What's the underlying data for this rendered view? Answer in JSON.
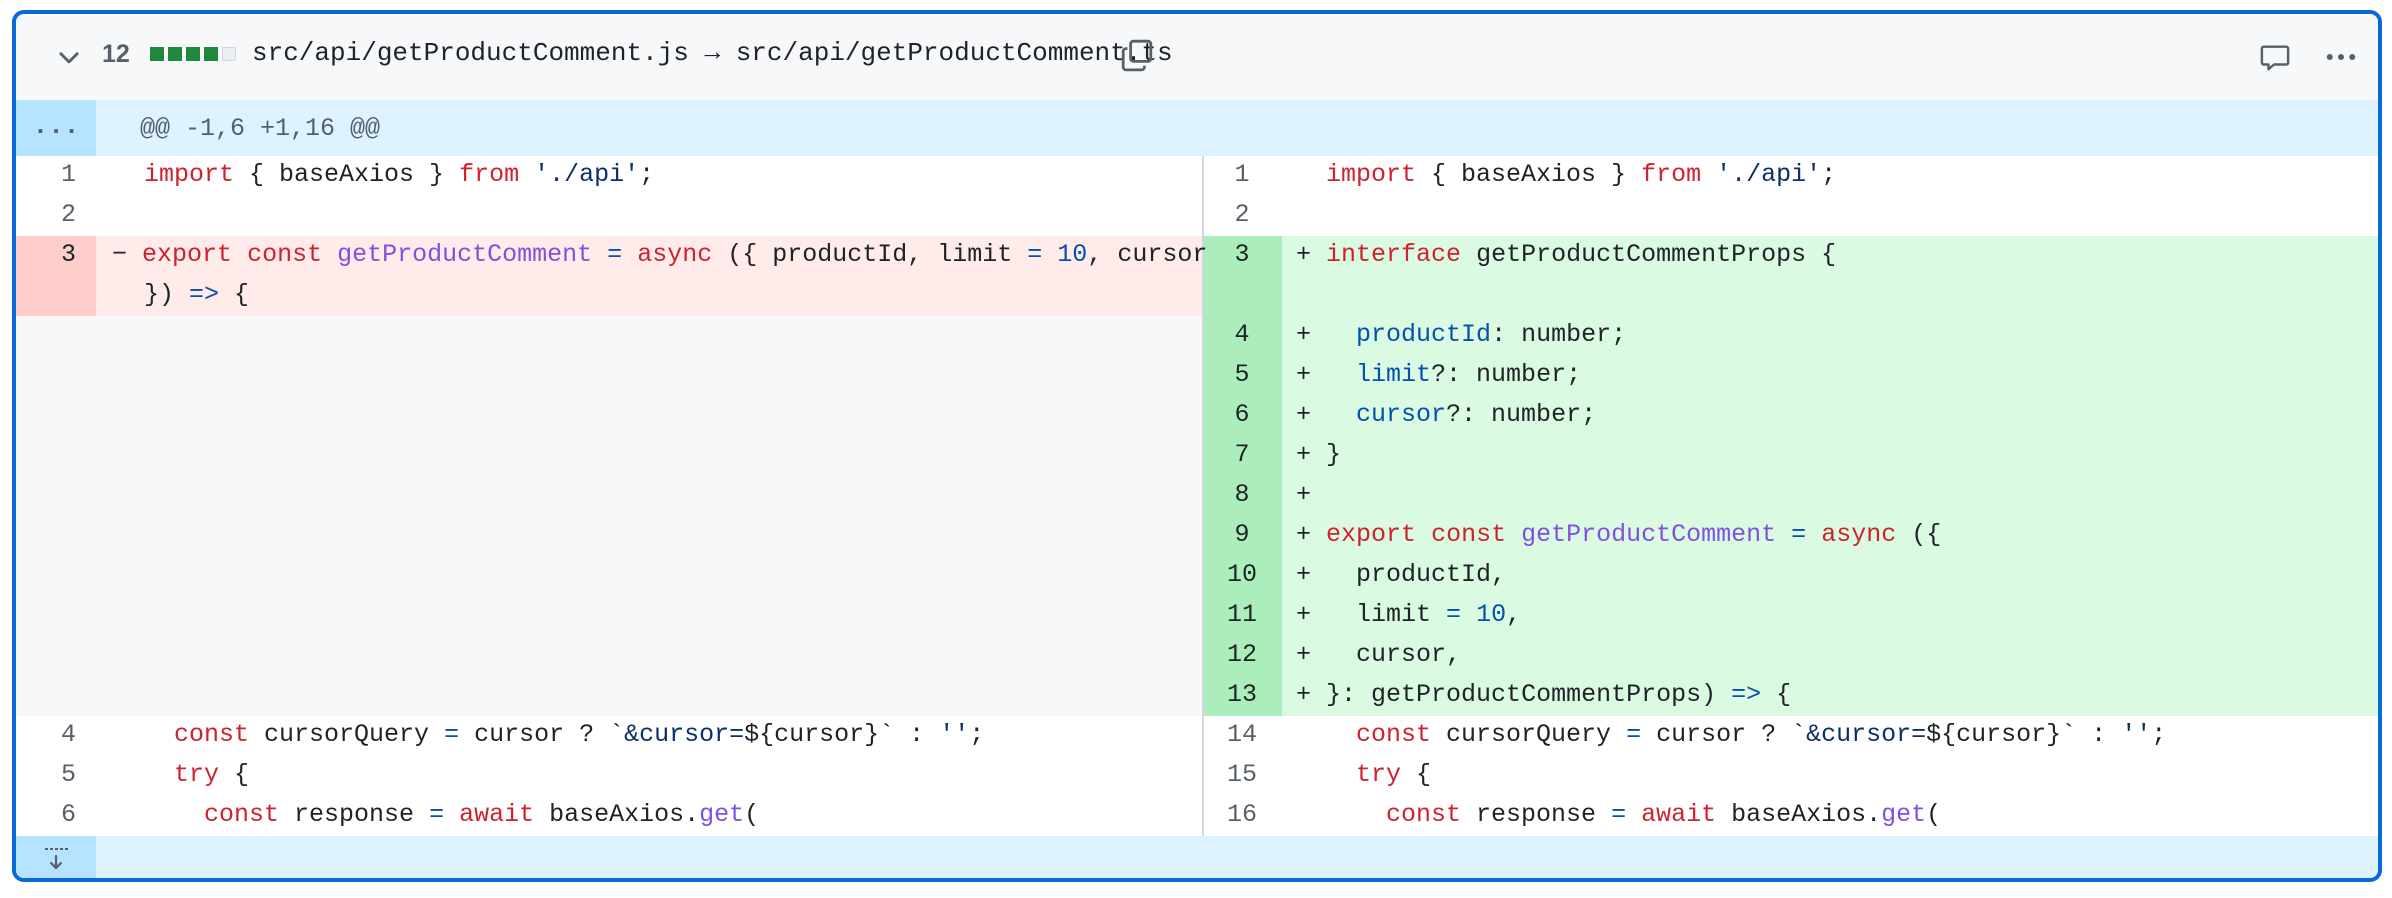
{
  "header": {
    "changes_count": "12",
    "diffstat": [
      "add",
      "add",
      "add",
      "add",
      "neutral"
    ],
    "old_path": "src/api/getProductComment.js",
    "arrow": "→",
    "new_path": "src/api/getProductComment.ts"
  },
  "hunk": {
    "expander": "...",
    "header": "@@ -1,6 +1,16 @@"
  },
  "left": {
    "lines": [
      {
        "n": "1"
      },
      {
        "n": "2"
      },
      {
        "n": "3"
      },
      {
        "n": "4"
      },
      {
        "n": "5"
      },
      {
        "n": "6"
      }
    ]
  },
  "right": {
    "lines": [
      {
        "n": "1"
      },
      {
        "n": "2"
      },
      {
        "n": "3"
      },
      {
        "n": "4"
      },
      {
        "n": "5"
      },
      {
        "n": "6"
      },
      {
        "n": "7"
      },
      {
        "n": "8"
      },
      {
        "n": "9"
      },
      {
        "n": "10"
      },
      {
        "n": "11"
      },
      {
        "n": "12"
      },
      {
        "n": "13"
      },
      {
        "n": "14"
      },
      {
        "n": "15"
      },
      {
        "n": "16"
      }
    ]
  },
  "code": {
    "import_kw": "import",
    "import_mid": " { baseAxios } ",
    "from_kw": "from",
    "import_str": "'./api'",
    "semi": ";",
    "del_sign": "−",
    "add_sign": "+",
    "export_kw": "export",
    "const_kw": "const",
    "fn_name": "getProductComment",
    "eq": "=",
    "async_kw": "async",
    "left_params_a": " ({ productId, limit ",
    "ten": "10",
    "left_params_b": ", cursor",
    "left_close_a": "}) ",
    "arrow_op": "=>",
    "brace_open": " {",
    "interface_kw": "interface",
    "iface_name": " getProductCommentProps {",
    "p_productId": "productId",
    "t_number": ": number;",
    "p_limit": "limit",
    "t_opt_number": "?: number;",
    "p_cursor": "cursor",
    "close_brace": "}",
    "open_paren": " ({",
    "productId_line": "productId,",
    "limit_line": "limit ",
    "limit_tail": ",",
    "cursor_line": "cursor,",
    "close_props_a": "}: getProductCommentProps) ",
    "cursorQuery_a": " cursorQuery ",
    "cursorQuery_b": " cursor ? `",
    "cursorQuery_c": "&cursor=",
    "cursorQuery_d": "${cursor}` : ",
    "empty_str": "''",
    "try_kw": "try",
    "response_a": " response ",
    "await_kw": "await",
    "response_b": " baseAxios.",
    "get_fn": "get",
    "paren": "("
  }
}
